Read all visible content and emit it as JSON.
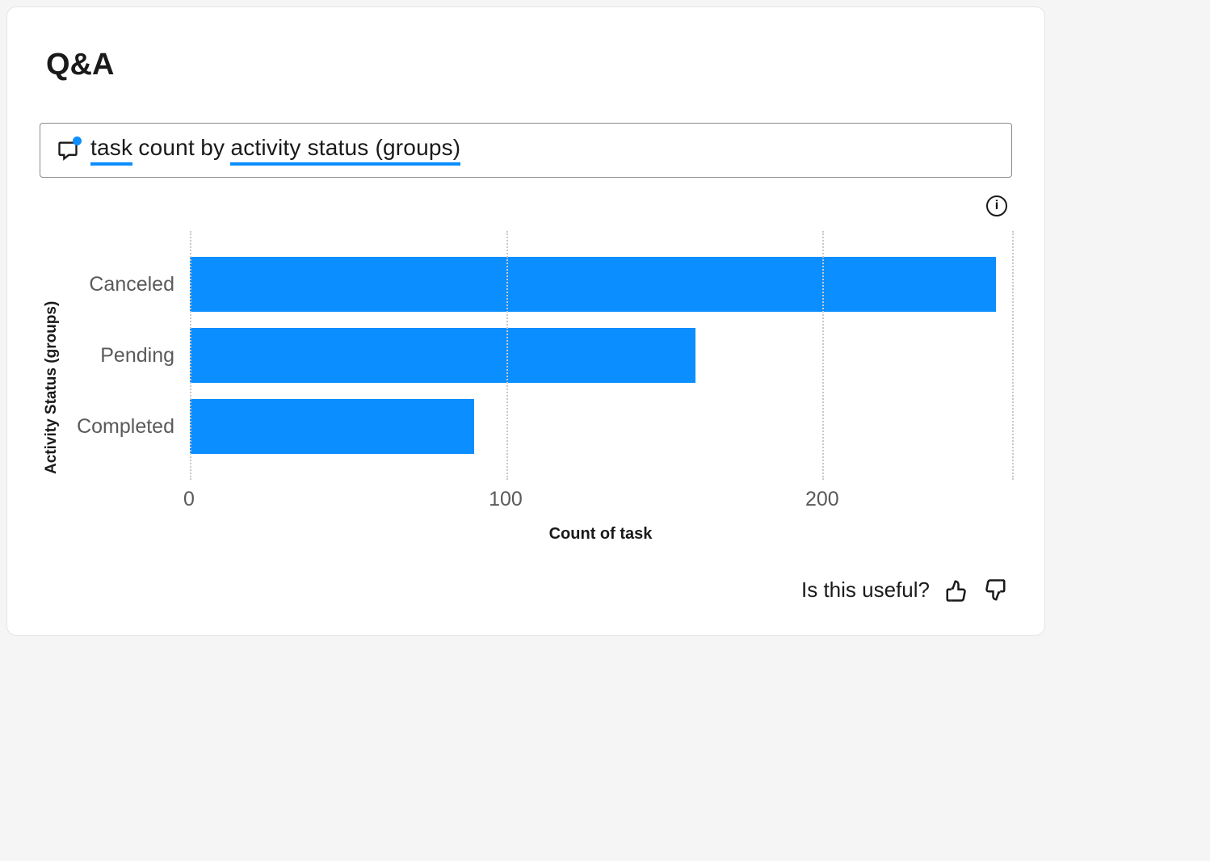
{
  "title": "Q&A",
  "query": {
    "tokens": [
      {
        "text": "task",
        "underline": true
      },
      {
        "text": "count",
        "underline": false
      },
      {
        "text": "by",
        "underline": false
      },
      {
        "text": "activity status (groups)",
        "underline": true
      }
    ]
  },
  "chart_data": {
    "type": "bar",
    "orientation": "horizontal",
    "categories": [
      "Canceled",
      "Pending",
      "Completed"
    ],
    "values": [
      255,
      160,
      90
    ],
    "xlabel": "Count of task",
    "ylabel": "Activity Status (groups)",
    "xlim": [
      0,
      260
    ],
    "xticks": [
      0,
      100,
      200
    ],
    "bar_color": "#0b8eff",
    "grid": true
  },
  "feedback": {
    "prompt": "Is this useful?"
  },
  "info_icon_label": "i"
}
